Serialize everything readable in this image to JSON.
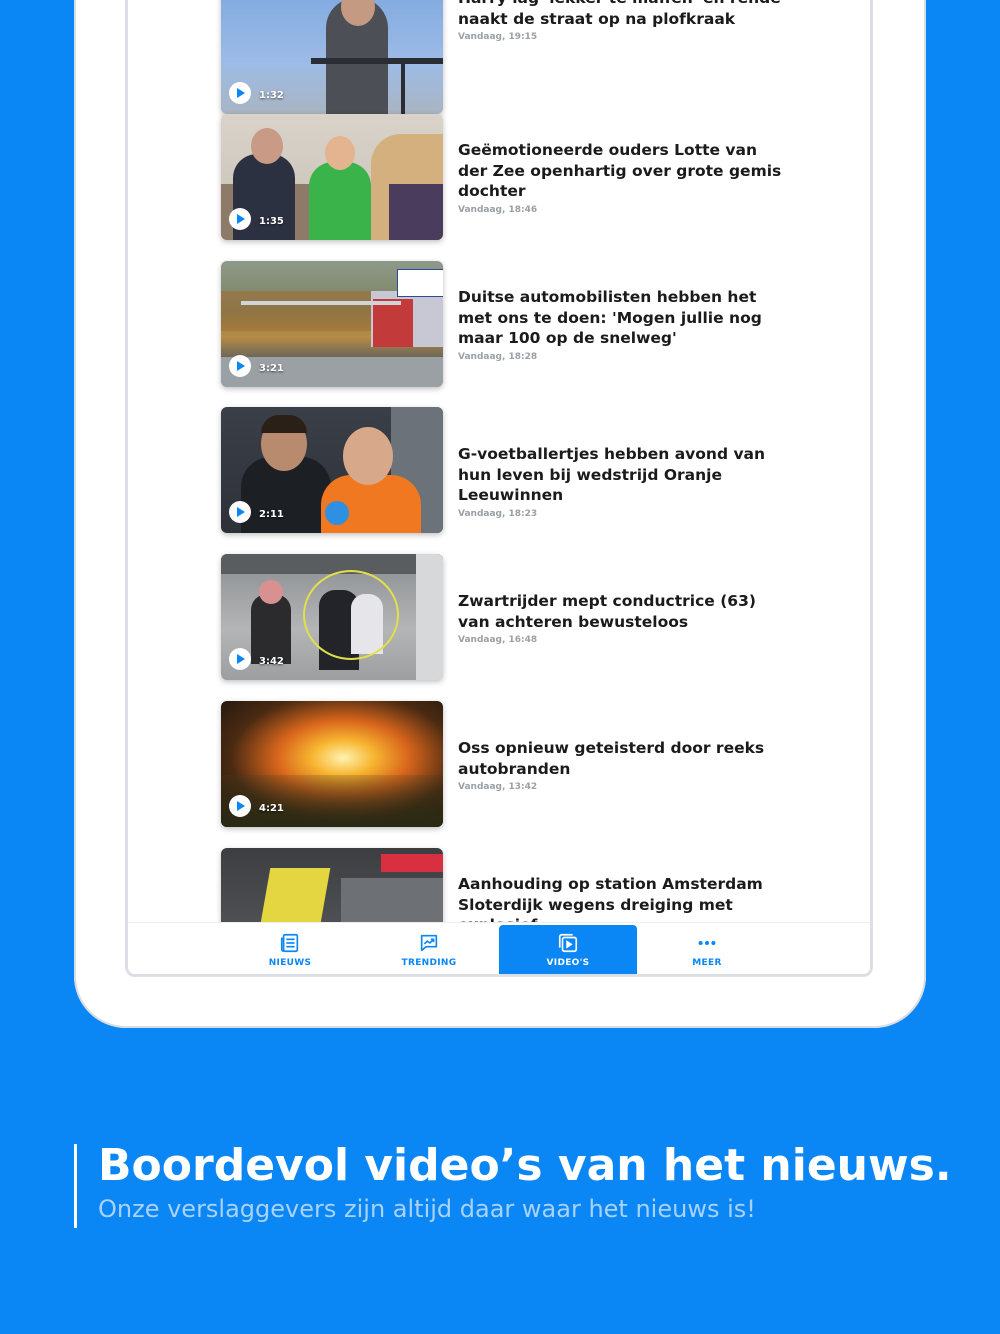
{
  "feed": {
    "items": [
      {
        "title": "Harry lag 'lekker te maffen' en rende naakt de straat op na plofkraak",
        "time": "Vandaag, 19:15",
        "duration": "1:32"
      },
      {
        "title": "Geëmotioneerde ouders Lotte van der Zee openhartig over grote gemis dochter",
        "time": "Vandaag, 18:46",
        "duration": "1:35"
      },
      {
        "title": "Duitse automobilisten hebben het met ons te doen: 'Mogen jullie nog maar 100 op de snelweg'",
        "time": "Vandaag, 18:28",
        "duration": "3:21"
      },
      {
        "title": "G-voetballertjes hebben avond van hun leven bij wedstrijd Oranje Leeuwinnen",
        "time": "Vandaag, 18:23",
        "duration": "2:11"
      },
      {
        "title": "Zwartrijder mept conductrice (63) van achteren bewusteloos",
        "time": "Vandaag, 16:48",
        "duration": "3:42"
      },
      {
        "title": "Oss opnieuw geteisterd door reeks autobranden",
        "time": "Vandaag, 13:42",
        "duration": "4:21"
      },
      {
        "title": "Aanhouding op station Amsterdam Sloterdijk wegens dreiging met explosief",
        "time": "",
        "duration": ""
      }
    ]
  },
  "tabbar": {
    "nieuws": "NIEUWS",
    "trending": "TRENDING",
    "videos": "VIDEO'S",
    "meer": "MEER",
    "active": "videos"
  },
  "caption": {
    "headline": "Boordevol video’s van het nieuws.",
    "subline": "Onze verslaggevers zijn altijd daar waar het nieuws is!"
  },
  "colors": {
    "brand": "#0a86f5",
    "text": "#1b1b1b",
    "muted": "#9aa0a6"
  },
  "icons": [
    "play-icon",
    "newspaper-icon",
    "trending-icon",
    "video-icon",
    "more-icon"
  ]
}
